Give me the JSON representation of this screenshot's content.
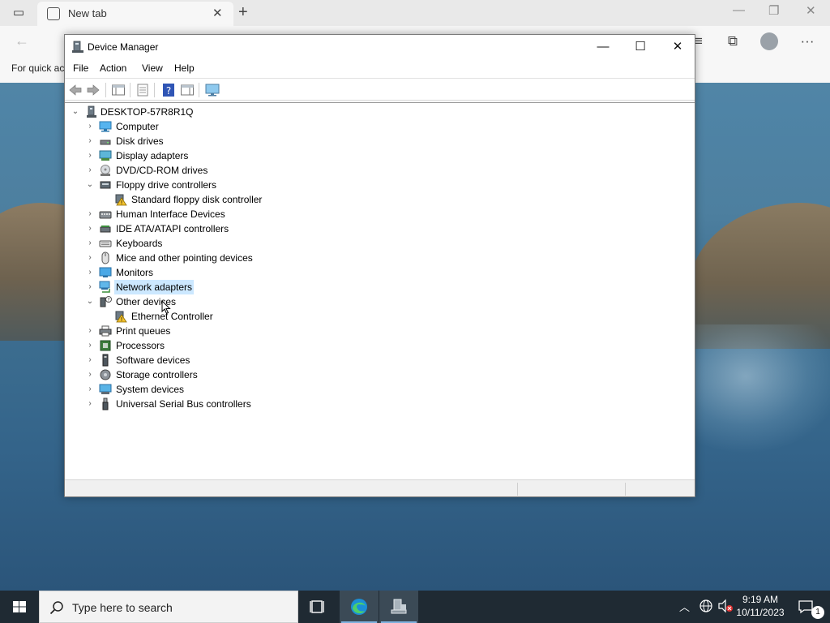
{
  "browser": {
    "tab_title": "New tab",
    "quick_access_text": "For quick ac"
  },
  "window": {
    "title": "Device Manager",
    "menu": [
      "File",
      "Action",
      "View",
      "Help"
    ]
  },
  "tree": {
    "root": "DESKTOP-57R8R1Q",
    "items": [
      {
        "label": "Computer",
        "expanded": false,
        "icon": "computer-icon"
      },
      {
        "label": "Disk drives",
        "expanded": false,
        "icon": "disk-drive-icon"
      },
      {
        "label": "Display adapters",
        "expanded": false,
        "icon": "display-adapter-icon"
      },
      {
        "label": "DVD/CD-ROM drives",
        "expanded": false,
        "icon": "dvd-drive-icon"
      },
      {
        "label": "Floppy drive controllers",
        "expanded": true,
        "icon": "floppy-controller-icon"
      },
      {
        "label": "Standard floppy disk controller",
        "child": true,
        "icon": "warning-device-icon"
      },
      {
        "label": "Human Interface Devices",
        "expanded": false,
        "icon": "hid-icon"
      },
      {
        "label": "IDE ATA/ATAPI controllers",
        "expanded": false,
        "icon": "ide-controller-icon"
      },
      {
        "label": "Keyboards",
        "expanded": false,
        "icon": "keyboard-icon"
      },
      {
        "label": "Mice and other pointing devices",
        "expanded": false,
        "icon": "mouse-icon"
      },
      {
        "label": "Monitors",
        "expanded": false,
        "icon": "monitor-icon"
      },
      {
        "label": "Network adapters",
        "expanded": false,
        "selected": true,
        "icon": "network-adapter-icon"
      },
      {
        "label": "Other devices",
        "expanded": true,
        "icon": "unknown-device-icon"
      },
      {
        "label": "Ethernet Controller",
        "child": true,
        "icon": "warning-device-icon"
      },
      {
        "label": "Print queues",
        "expanded": false,
        "icon": "printer-icon"
      },
      {
        "label": "Processors",
        "expanded": false,
        "icon": "processor-icon"
      },
      {
        "label": "Software devices",
        "expanded": false,
        "icon": "software-device-icon"
      },
      {
        "label": "Storage controllers",
        "expanded": false,
        "icon": "storage-controller-icon"
      },
      {
        "label": "System devices",
        "expanded": false,
        "icon": "system-device-icon"
      },
      {
        "label": "Universal Serial Bus controllers",
        "expanded": false,
        "icon": "usb-icon"
      }
    ]
  },
  "taskbar": {
    "search_placeholder": "Type here to search",
    "time": "9:19 AM",
    "date": "10/11/2023",
    "notification_count": "1"
  },
  "colors": {
    "selection": "#cce8ff",
    "taskbar": "#1f2a33",
    "warning": "#f2c12e"
  }
}
